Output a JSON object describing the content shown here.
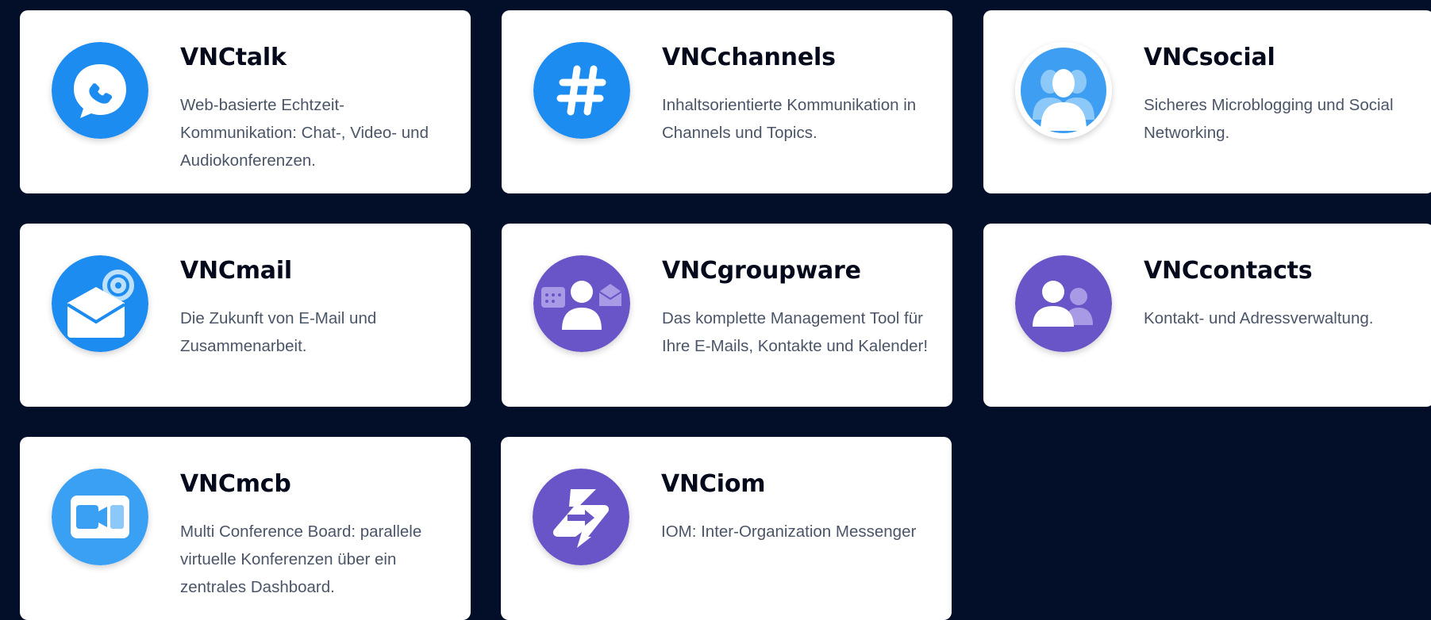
{
  "colors": {
    "background": "#030f28",
    "card": "#ffffff",
    "blue": "#1d8cf0",
    "purple": "#6a55c8",
    "title": "#04091c",
    "text": "#4b5568"
  },
  "apps": [
    {
      "title": "VNCtalk",
      "description": "Web-basierte Echtzeit-Kommunikation: Chat-, Video- und Audiokonferenzen.",
      "icon": "phone-chat-icon"
    },
    {
      "title": "VNCchannels",
      "description": "Inhaltsorientierte Kommunikation in Channels und Topics.",
      "icon": "hashtag-icon"
    },
    {
      "title": "VNCsocial",
      "description": "Sicheres Microblogging und Social Networking.",
      "icon": "users-silhouette-icon"
    },
    {
      "title": "VNCmail",
      "description": "Die Zukunft von E-Mail und Zusammenarbeit.",
      "icon": "envelope-at-icon"
    },
    {
      "title": "VNCgroupware",
      "description": "Das komplette Management Tool für Ihre E-Mails, Kontakte und Kalender!",
      "icon": "groupware-icon"
    },
    {
      "title": "VNCcontacts",
      "description": "Kontakt- und Adressverwaltung.",
      "icon": "contacts-icon"
    },
    {
      "title": "VNCmcb",
      "description": "Multi Conference Board: parallele virtuelle Konferenzen über ein zentrales Dashboard.",
      "icon": "multi-conference-icon"
    },
    {
      "title": "VNCiom",
      "description": "IOM: Inter-Organization Messenger",
      "icon": "exchange-arrows-icon"
    }
  ]
}
